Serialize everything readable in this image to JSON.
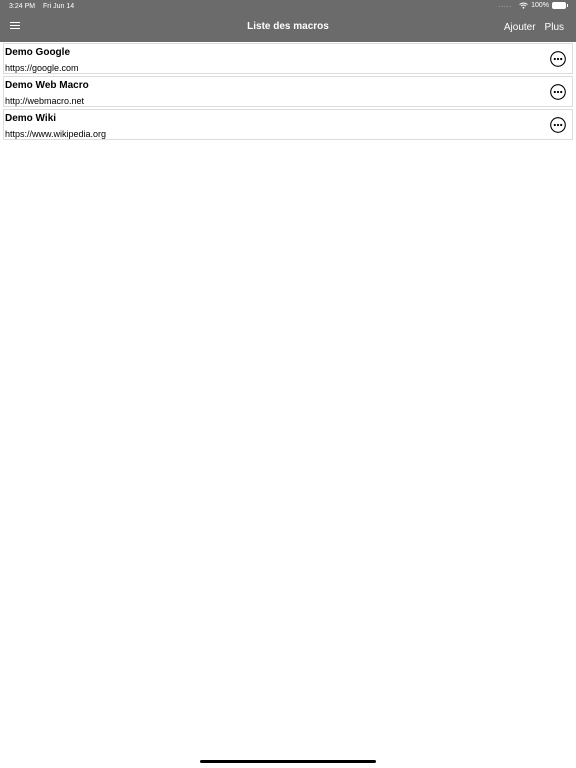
{
  "status_bar": {
    "time": "3:24 PM",
    "date": "Fri Jun 14",
    "signal_dots": ".....",
    "wifi_icon": "wifi-icon",
    "battery_text": "100%",
    "battery_icon": "battery-icon",
    "battery_level": 1.0
  },
  "nav": {
    "menu_icon": "hamburger-menu-icon",
    "title": "Liste des macros",
    "add_label": "Ajouter",
    "more_label": "Plus"
  },
  "macros": [
    {
      "name": "Demo Google",
      "url": "https://google.com",
      "action_icon": "more-options-icon"
    },
    {
      "name": "Demo Web Macro",
      "url": "http://webmacro.net",
      "action_icon": "more-options-icon"
    },
    {
      "name": "Demo Wiki",
      "url": "https://www.wikipedia.org",
      "action_icon": "more-options-icon"
    }
  ],
  "colors": {
    "nav_background": "#6b6b6b",
    "nav_text": "#ffffff",
    "row_border": "#dcdcdc",
    "page_background": "#ffffff"
  }
}
